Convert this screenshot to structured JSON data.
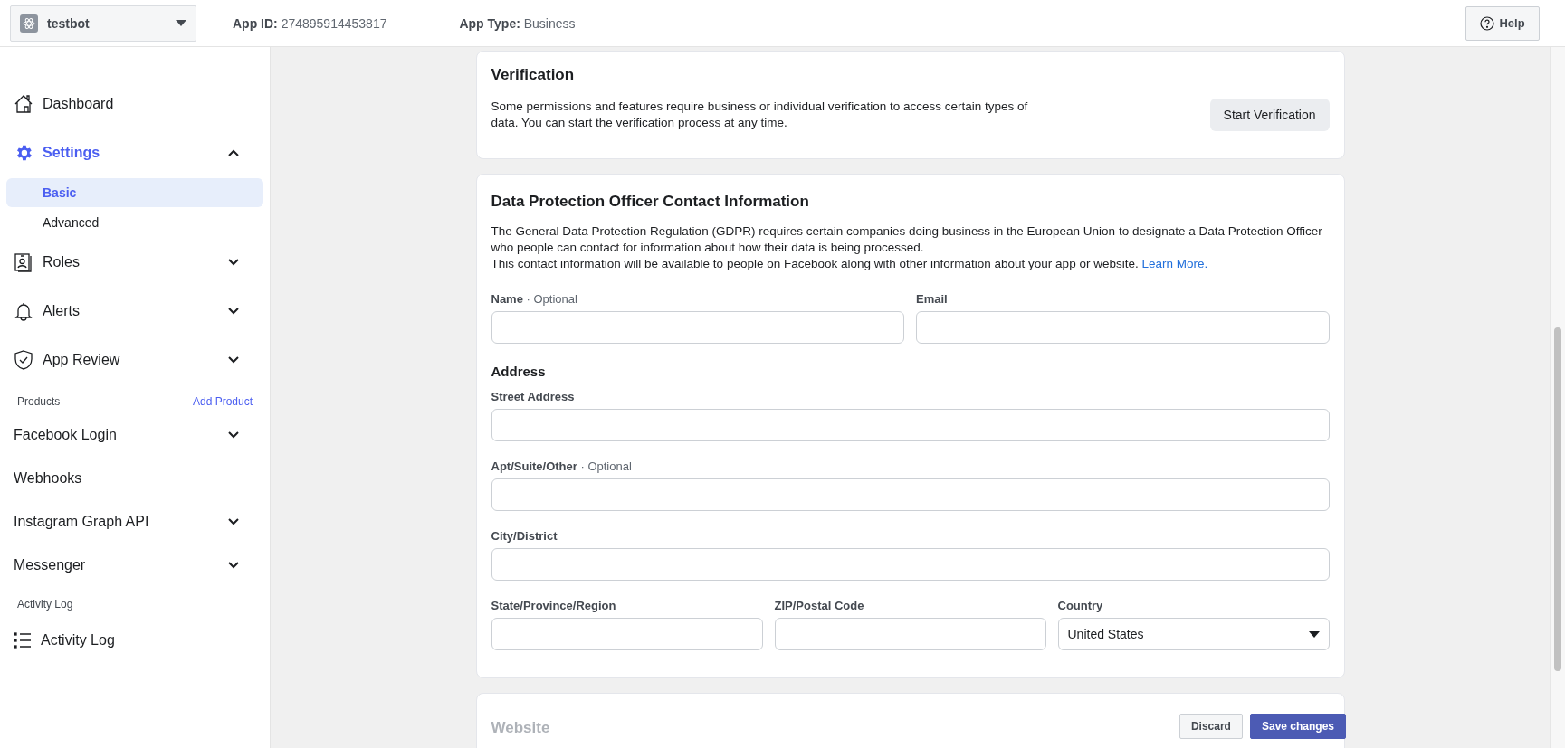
{
  "top_bar": {
    "app_name": "testbot",
    "app_id_label": "App ID:",
    "app_id": "274895914453817",
    "app_type_label": "App Type:",
    "app_type": "Business",
    "help": "Help"
  },
  "sidebar": {
    "sections": [
      {
        "items": [
          {
            "kind": "link",
            "label": "Dashboard",
            "selected": false
          },
          {
            "kind": "expandable",
            "label": "Settings",
            "selected": true,
            "expanded": true,
            "children": [
              {
                "label": "Basic",
                "selected": true
              },
              {
                "label": "Advanced",
                "selected": false
              }
            ]
          },
          {
            "kind": "expandable",
            "label": "Roles",
            "selected": false,
            "expanded": false
          },
          {
            "kind": "expandable",
            "label": "Alerts",
            "selected": false,
            "expanded": false
          },
          {
            "kind": "expandable",
            "label": "App Review",
            "selected": false,
            "expanded": false
          }
        ]
      },
      {
        "header": "Products",
        "action": "Add Product",
        "items": [
          {
            "kind": "expandable",
            "label": "Facebook Login",
            "selected": false,
            "expanded": false
          },
          {
            "kind": "link",
            "label": "Webhooks",
            "selected": false
          },
          {
            "kind": "expandable",
            "label": "Instagram Graph API",
            "selected": false,
            "expanded": false
          },
          {
            "kind": "expandable",
            "label": "Messenger",
            "selected": false,
            "expanded": false
          }
        ]
      },
      {
        "header": "Activity Log",
        "items": [
          {
            "kind": "link",
            "label": "Activity Log",
            "selected": false
          }
        ]
      }
    ]
  },
  "verification": {
    "title": "Verification",
    "text": "Some permissions and features require business or individual verification to access certain types of data. You can start the verification process at any time.",
    "button": "Start Verification"
  },
  "dpo": {
    "title": "Data Protection Officer Contact Information",
    "paragraphs": [
      "The General Data Protection Regulation (GDPR) requires certain companies doing business in the European Union to designate a Data Protection Officer who people can contact for information about how their data is being processed.",
      "This contact information will be available to people on Facebook along with other information about your app or website."
    ],
    "link": "Learn More.",
    "rows": [
      [
        {
          "label": "Name",
          "optional": "· Optional"
        },
        {
          "label": "Email"
        }
      ],
      [
        {
          "heading": "Address"
        }
      ],
      [
        {
          "label": "Street Address"
        }
      ],
      [
        {
          "label": "Apt/Suite/Other",
          "optional": "· Optional"
        }
      ],
      [
        {
          "label": "City/District"
        }
      ],
      [
        {
          "label": "State/Province/Region"
        },
        {
          "label": "ZIP/Postal Code"
        },
        {
          "label": "Country",
          "kind": "select",
          "value": "United States"
        }
      ]
    ]
  },
  "website": {
    "title": "Website"
  },
  "save_bar": {
    "discard": "Discard",
    "save": "Save changes"
  }
}
